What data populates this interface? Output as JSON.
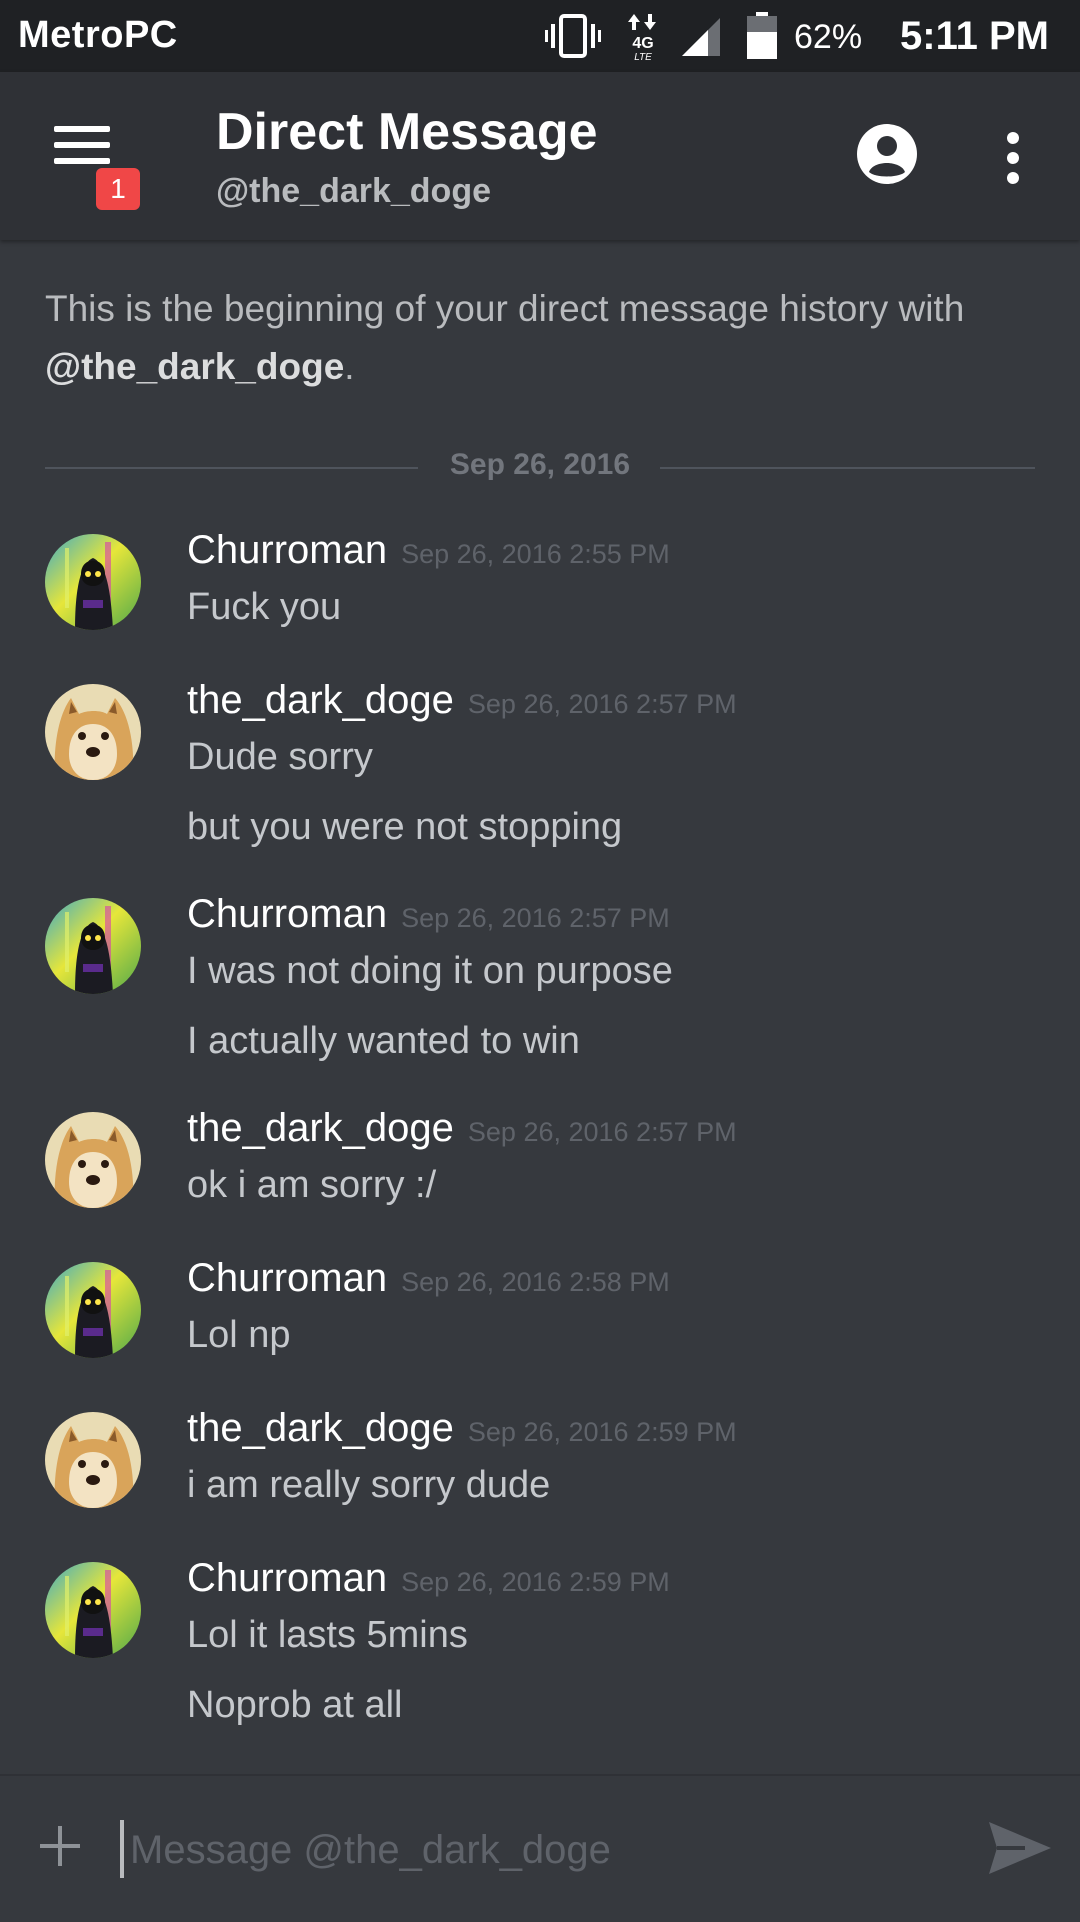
{
  "status_bar": {
    "carrier": "MetroPC",
    "network": "4G",
    "battery_percent": "62%",
    "time": "5:11 PM"
  },
  "header": {
    "title": "Direct Message",
    "subtitle": "@the_dark_doge",
    "badge_count": "1"
  },
  "intro": {
    "text": "This is the beginning of your direct message history with ",
    "mention": "@the_dark_doge",
    "suffix": "."
  },
  "date_divider": "Sep 26, 2016",
  "messages": [
    {
      "author": "Churroman",
      "timestamp": "Sep 26, 2016 2:55 PM",
      "avatar": "hooded-figure",
      "lines": [
        "Fuck you"
      ]
    },
    {
      "author": "the_dark_doge",
      "timestamp": "Sep 26, 2016 2:57 PM",
      "avatar": "doge",
      "lines": [
        "Dude sorry",
        "but you were not stopping"
      ]
    },
    {
      "author": "Churroman",
      "timestamp": "Sep 26, 2016 2:57 PM",
      "avatar": "hooded-figure",
      "lines": [
        "I was not doing it on purpose",
        "I actually wanted to win"
      ]
    },
    {
      "author": "the_dark_doge",
      "timestamp": "Sep 26, 2016 2:57 PM",
      "avatar": "doge",
      "lines": [
        "ok i am sorry :/"
      ]
    },
    {
      "author": "Churroman",
      "timestamp": "Sep 26, 2016 2:58 PM",
      "avatar": "hooded-figure",
      "lines": [
        "Lol np"
      ]
    },
    {
      "author": "the_dark_doge",
      "timestamp": "Sep 26, 2016 2:59 PM",
      "avatar": "doge",
      "lines": [
        "i am really sorry dude"
      ]
    },
    {
      "author": "Churroman",
      "timestamp": "Sep 26, 2016 2:59 PM",
      "avatar": "hooded-figure",
      "lines": [
        "Lol it lasts 5mins",
        "Noprob at all"
      ]
    }
  ],
  "composer": {
    "placeholder": "Message @the_dark_doge"
  },
  "colors": {
    "background": "#36393e",
    "header": "#2f3136",
    "status_bar": "#1f2124",
    "badge": "#f04747"
  }
}
